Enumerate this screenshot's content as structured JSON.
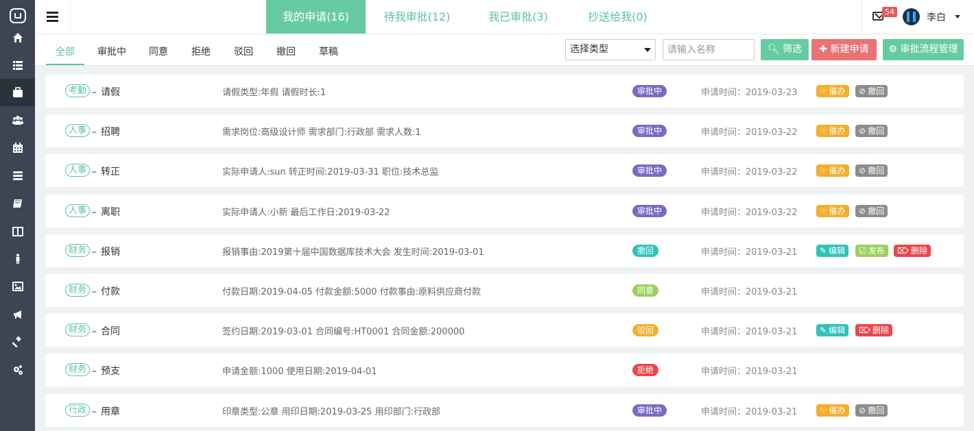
{
  "sidebar": {
    "items": [
      {
        "icon": "home-icon"
      },
      {
        "icon": "list-icon"
      },
      {
        "icon": "briefcase-icon",
        "active": true
      },
      {
        "icon": "users-icon"
      },
      {
        "icon": "calendar-icon"
      },
      {
        "icon": "server-icon"
      },
      {
        "icon": "book-icon"
      },
      {
        "icon": "columns-icon"
      },
      {
        "icon": "person-icon"
      },
      {
        "icon": "image-icon"
      },
      {
        "icon": "bullhorn-icon"
      },
      {
        "icon": "gavel-icon"
      },
      {
        "icon": "cogs-icon"
      }
    ]
  },
  "topbar": {
    "tabs": [
      {
        "label": "我的申请(16)",
        "active": true
      },
      {
        "label": "待我审批(12)"
      },
      {
        "label": "我已审批(3)"
      },
      {
        "label": "抄送给我(0)"
      }
    ],
    "notification_count": "54",
    "user_name": "李白"
  },
  "subbar": {
    "tabs": [
      {
        "label": "全部",
        "active": true
      },
      {
        "label": "审批中"
      },
      {
        "label": "同意"
      },
      {
        "label": "拒绝"
      },
      {
        "label": "驳回"
      },
      {
        "label": "撤回"
      },
      {
        "label": "草稿"
      }
    ],
    "type_select": "选择类型",
    "name_placeholder": "请输入名称",
    "filter_label": "筛选",
    "new_label": "新建申请",
    "manage_label": "审批流程管理"
  },
  "colors": {
    "accent": "#5cc39d",
    "status_pending": "#7a6bc4",
    "status_withdrawn": "#2ec4b6",
    "status_agree": "#9ed15c",
    "status_reject": "#e9484d",
    "status_returned": "#f6ae2d"
  },
  "time_label": "申请时间：",
  "action_labels": {
    "urge": "催办",
    "withdraw": "撤回",
    "edit": "编辑",
    "publish": "发布",
    "delete": "删除"
  },
  "requests": [
    {
      "category": "考勤",
      "name": "请假",
      "detail": "请假类型:年假 请假时长:1",
      "status": "审批中",
      "status_type": "pending",
      "date": "2019-03-23",
      "actions": [
        "urge",
        "withdraw"
      ]
    },
    {
      "category": "人事",
      "name": "招聘",
      "detail": "需求岗位:高级设计师 需求部门:行政部 需求人数:1",
      "status": "审批中",
      "status_type": "pending",
      "date": "2019-03-22",
      "actions": [
        "urge",
        "withdraw"
      ]
    },
    {
      "category": "人事",
      "name": "转正",
      "detail": "实际申请人:sun 转正时间:2019-03-31 职位:技术总监",
      "status": "审批中",
      "status_type": "pending",
      "date": "2019-03-22",
      "actions": [
        "urge",
        "withdraw"
      ]
    },
    {
      "category": "人事",
      "name": "离职",
      "detail": "实际申请人:小新 最后工作日:2019-03-22",
      "status": "审批中",
      "status_type": "pending",
      "date": "2019-03-22",
      "actions": [
        "urge",
        "withdraw"
      ]
    },
    {
      "category": "财务",
      "name": "报销",
      "detail": "报销事由:2019第十届中国数据库技术大会 发生时间:2019-03-01",
      "status": "撤回",
      "status_type": "withdrawn",
      "date": "2019-03-21",
      "actions": [
        "edit",
        "publish",
        "delete"
      ]
    },
    {
      "category": "财务",
      "name": "付款",
      "detail": "付款日期:2019-04-05 付款金额:5000 付款事由:原料供应商付款",
      "status": "同意",
      "status_type": "agree",
      "date": "2019-03-21",
      "actions": []
    },
    {
      "category": "财务",
      "name": "合同",
      "detail": "签约日期:2019-03-01 合同编号:HT0001 合同金额:200000",
      "status": "驳回",
      "status_type": "returned",
      "date": "2019-03-21",
      "actions": [
        "edit",
        "delete"
      ]
    },
    {
      "category": "财务",
      "name": "预支",
      "detail": "申请金额:1000 使用日期:2019-04-01",
      "status": "拒绝",
      "status_type": "reject",
      "date": "2019-03-21",
      "actions": []
    },
    {
      "category": "行政",
      "name": "用章",
      "detail": "印章类型:公章 用印日期:2019-03-25 用印部门:行政部",
      "status": "审批中",
      "status_type": "pending",
      "date": "2019-03-21",
      "actions": [
        "urge",
        "withdraw"
      ]
    }
  ]
}
